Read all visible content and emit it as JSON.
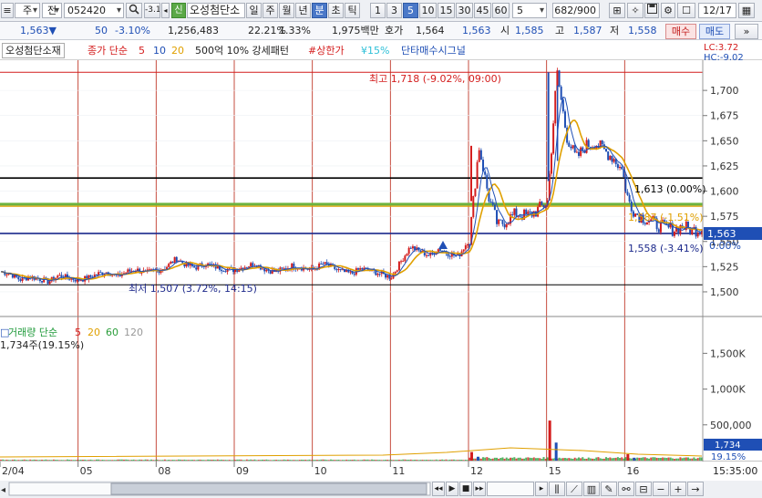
{
  "toolbar": {
    "market_type": "주",
    "exchange": "전",
    "code": "052420",
    "change_pct_field": "-3.10",
    "new_badge": "신",
    "stock_name": "오성첨단소",
    "period_buttons": [
      "일",
      "주",
      "월",
      "년",
      "분",
      "초",
      "틱"
    ],
    "active_period": "분",
    "interval_buttons": [
      "1",
      "3",
      "5",
      "10",
      "15",
      "30",
      "45",
      "60"
    ],
    "active_interval": "5",
    "interval_value": "5",
    "count": "682/900",
    "date": "12/17"
  },
  "quote": {
    "price": "1,563▼",
    "change": "50",
    "change_pct": "-3.10%",
    "volume": "1,256,483",
    "turnover_pct": "22.21%",
    "ratio": "1.33%",
    "amount": "1,975백만",
    "bid_label": "호가",
    "bid": "1,564",
    "ask": "1,563",
    "open_label": "시",
    "open": "1,585",
    "high_label": "고",
    "high": "1,587",
    "low_label": "저",
    "low": "1,558",
    "buy_label": "매수",
    "sell_label": "매도"
  },
  "legend": {
    "name": "오성첨단소재",
    "ma_label": "종가 단순",
    "ma5": "5",
    "ma10": "10",
    "ma20": "20",
    "pattern": "500억 10% 강세패턴",
    "upper_limit": "#상한가",
    "pct15": "¥15%",
    "signal": "단타매수시그널",
    "lc": "LC:3.72",
    "hc": "HC:-9.02"
  },
  "annotations": {
    "high": "최고 1,718 (-9.02%, 09:00)",
    "low": "최저 1,507 (3.72%, 14:15)",
    "line_1613": "1,613 (0.00%)",
    "line_1587": "1,587 (-1.51%)",
    "line_1558": "1,558 (-3.41%)",
    "current_price": "1,563",
    "current_pct": "0.00%"
  },
  "volume": {
    "legend_label": "거래량 단순",
    "ma5": "5",
    "ma20": "20",
    "ma60": "60",
    "ma120": "120",
    "last": "1,734주(19.15%)",
    "current": "1,734",
    "current_pct": "19.15%"
  },
  "colors": {
    "up": "#d41d1d",
    "down": "#1f4fb5",
    "ma5": "#d41d1d",
    "ma10": "#1f4fb5",
    "ma20": "#e0a000",
    "ma60": "#2a9d3a",
    "ma120": "#999999",
    "level_black": "#000000",
    "level_navy": "#1c2a8c",
    "level_green": "#6db33f",
    "level_orange": "#e0a000"
  },
  "chart_data": {
    "type": "candlestick",
    "price_axis_ticks": [
      "1,700",
      "1,675",
      "1,650",
      "1,625",
      "1,600",
      "1,575",
      "1,550",
      "1,525",
      "1,500"
    ],
    "volume_axis_ticks": [
      "1,500K",
      "1,000K",
      "500,000"
    ],
    "x_ticks": [
      "2/04",
      "05",
      "08",
      "09",
      "10",
      "11",
      "12",
      "15",
      "16"
    ],
    "time_label": "15:35:00",
    "price_range": [
      1490,
      1730
    ],
    "volume_range": [
      0,
      1900000
    ],
    "levels": [
      1718,
      1613,
      1587,
      1558,
      1507
    ],
    "sessions": [
      {
        "label": "2/04",
        "path": [
          1520,
          1518,
          1512,
          1515,
          1513,
          1510,
          1516,
          1514,
          1512
        ]
      },
      {
        "label": "05",
        "path": [
          1512,
          1514,
          1518,
          1520,
          1515,
          1520,
          1522,
          1519,
          1521
        ]
      },
      {
        "label": "08",
        "path": [
          1521,
          1525,
          1533,
          1527,
          1524,
          1528,
          1525,
          1523,
          1522
        ]
      },
      {
        "label": "09",
        "path": [
          1522,
          1525,
          1528,
          1523,
          1520,
          1522,
          1526,
          1524,
          1522
        ]
      },
      {
        "label": "10",
        "path": [
          1522,
          1528,
          1524,
          1520,
          1518,
          1523,
          1521,
          1518,
          1515
        ]
      },
      {
        "label": "11",
        "path": [
          1515,
          1530,
          1545,
          1540,
          1536,
          1543,
          1538,
          1535,
          1550
        ]
      },
      {
        "label": "12",
        "path": [
          1552,
          1645,
          1595,
          1565,
          1572,
          1578,
          1575,
          1580,
          1588
        ]
      },
      {
        "label": "15",
        "path": [
          1590,
          1718,
          1655,
          1632,
          1645,
          1648,
          1640,
          1632,
          1618
        ]
      },
      {
        "label": "16",
        "path": [
          1598,
          1578,
          1573,
          1568,
          1564,
          1562,
          1565,
          1561,
          1563
        ]
      }
    ],
    "volume_spikes": [
      {
        "session": "12",
        "value": 120000
      },
      {
        "session": "15",
        "value": 560000
      },
      {
        "session": "16",
        "value": 90000
      }
    ]
  }
}
